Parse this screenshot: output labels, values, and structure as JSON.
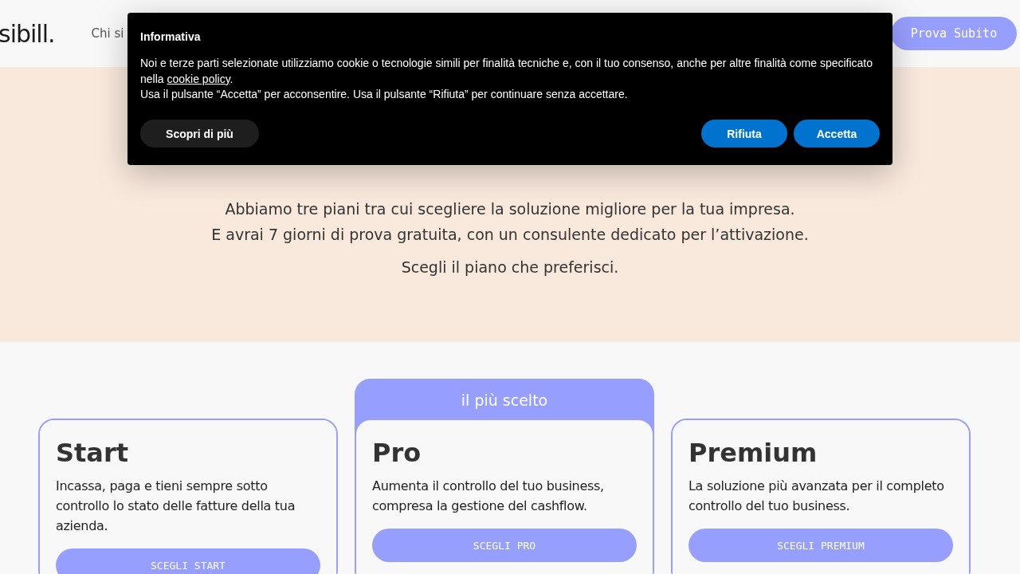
{
  "header": {
    "logo": "sibill.",
    "nav": [
      "Chi si"
    ],
    "cta": "Prova Subito"
  },
  "hero": {
    "lines": [
      "Abbiamo tre piani tra cui scegliere la soluzione migliore per la tua impresa.",
      "E avrai 7 giorni di prova gratuita, con un consulente dedicato per l’attivazione."
    ],
    "prompt": "Scegli il piano che preferisci."
  },
  "plans": [
    {
      "name": "Start",
      "description": "Incassa, paga e tieni sempre sotto controllo lo stato delle fatture della tua azienda.",
      "button": "SCEGLI START",
      "highlighted": false
    },
    {
      "name": "Pro",
      "description": "Aumenta il controllo del tuo business, compresa la gestione del cashflow.",
      "button": "SCEGLI PRO",
      "highlighted": true,
      "badge": "il più scelto"
    },
    {
      "name": "Premium",
      "description": "La soluzione più avanzata per il completo controllo del tuo business.",
      "button": "SCEGLI PREMIUM",
      "highlighted": false
    }
  ],
  "cookie_banner": {
    "title": "Informativa",
    "text_before": "Noi e terze parti selezionate utilizziamo cookie o tecnologie simili per finalità tecniche e, con il tuo consenso, anche per altre finalità come specificato nella",
    "link": "cookie policy",
    "text_after": ".",
    "second_line": "Usa il pulsante “Accetta” per acconsentire. Usa il pulsante “Rifiuta” per continuare senza accettare.",
    "buttons": [
      {
        "label": "Scopri di più",
        "kind": "secondary"
      },
      {
        "label": "Rifiuta",
        "kind": "primary"
      },
      {
        "label": "Accetta",
        "kind": "primary"
      }
    ]
  }
}
